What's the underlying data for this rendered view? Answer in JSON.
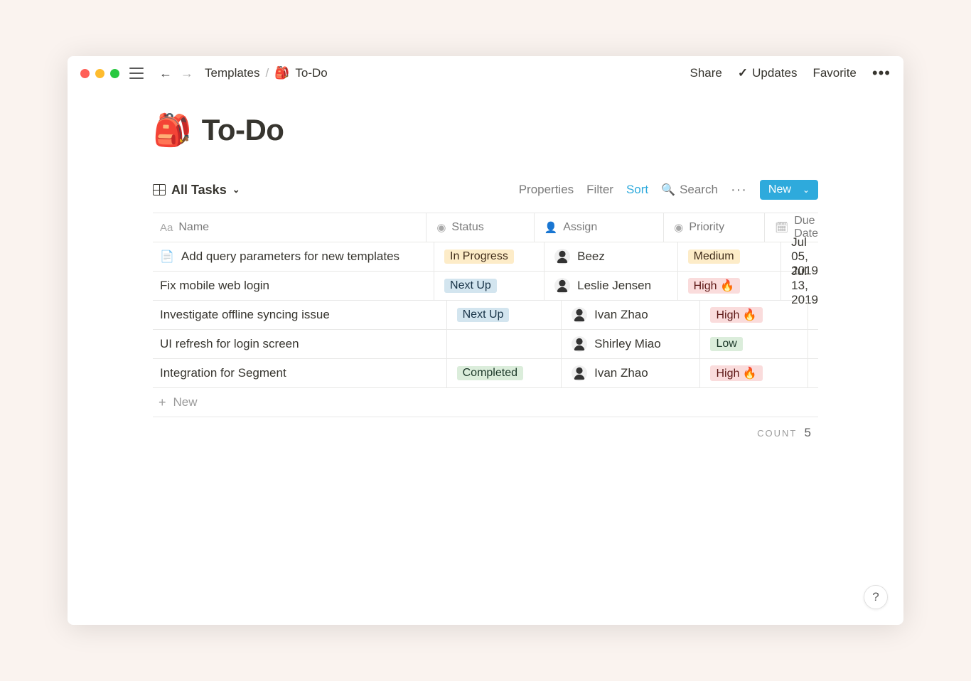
{
  "breadcrumbs": {
    "parent": "Templates",
    "sep": "/",
    "current": "To-Do",
    "icon": "🎒"
  },
  "topbar": {
    "share": "Share",
    "updates": "Updates",
    "favorite": "Favorite"
  },
  "page": {
    "icon": "🎒",
    "title": "To-Do"
  },
  "view": {
    "name": "All Tasks"
  },
  "db_actions": {
    "properties": "Properties",
    "filter": "Filter",
    "sort": "Sort",
    "search": "Search",
    "new": "New"
  },
  "columns": {
    "name": "Name",
    "status": "Status",
    "assign": "Assign",
    "priority": "Priority",
    "due": "Due Date"
  },
  "rows": [
    {
      "has_icon": true,
      "name": "Add query parameters for new templates",
      "status": "In Progress",
      "status_color": "yellow",
      "assign": "Beez",
      "priority": "Medium",
      "priority_color": "yellow",
      "due": "Jul 05, 2019"
    },
    {
      "has_icon": false,
      "name": "Fix mobile web login",
      "status": "Next Up",
      "status_color": "blue",
      "assign": "Leslie Jensen",
      "priority": "High 🔥",
      "priority_color": "pink",
      "due": "Jul 13, 2019"
    },
    {
      "has_icon": false,
      "name": "Investigate offline syncing issue",
      "status": "Next Up",
      "status_color": "blue",
      "assign": "Ivan Zhao",
      "priority": "High 🔥",
      "priority_color": "pink",
      "due": ""
    },
    {
      "has_icon": false,
      "name": "UI refresh for login screen",
      "status": "",
      "status_color": "",
      "assign": "Shirley Miao",
      "priority": "Low",
      "priority_color": "green",
      "due": ""
    },
    {
      "has_icon": false,
      "name": "Integration for Segment",
      "status": "Completed",
      "status_color": "green",
      "assign": "Ivan Zhao",
      "priority": "High 🔥",
      "priority_color": "pink",
      "due": ""
    }
  ],
  "new_row": "New",
  "count": {
    "label": "COUNT",
    "value": "5"
  },
  "help": "?"
}
